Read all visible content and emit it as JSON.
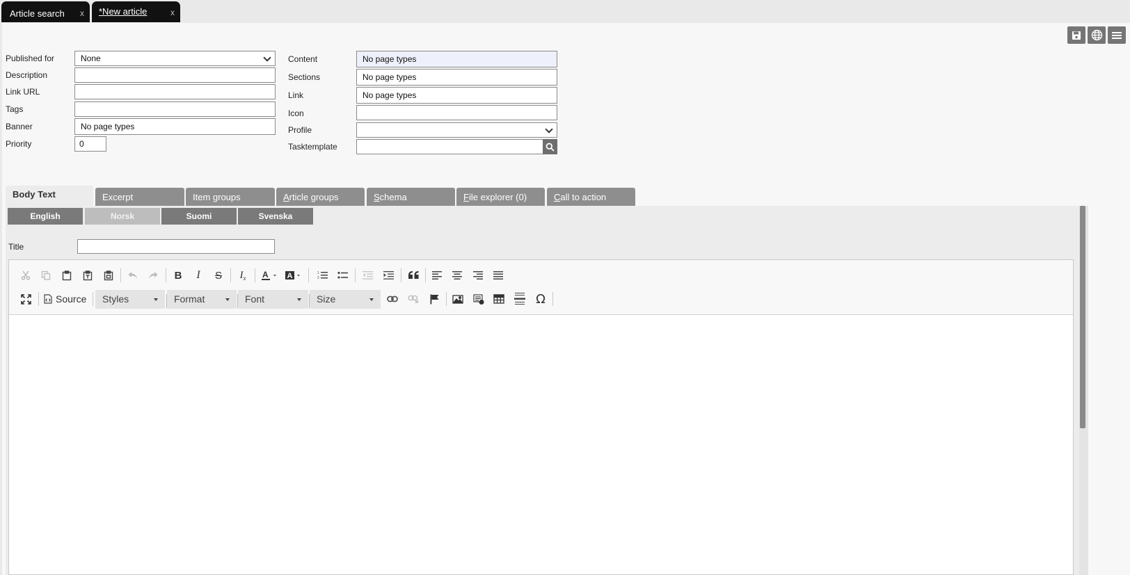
{
  "doc_tabs": [
    {
      "label": "Article search",
      "close": "x"
    },
    {
      "label": "*New article",
      "close": "x"
    }
  ],
  "top_icons": [
    "save-icon",
    "globe-icon",
    "menu-icon"
  ],
  "form_left": {
    "published_for": {
      "label": "Published for",
      "value": "None"
    },
    "description": {
      "label": "Description",
      "value": ""
    },
    "link_url": {
      "label": "Link URL",
      "value": ""
    },
    "tags": {
      "label": "Tags",
      "value": ""
    },
    "banner": {
      "label": "Banner",
      "value": "No page types"
    },
    "priority": {
      "label": "Priority",
      "value": "0"
    }
  },
  "form_right": {
    "content": {
      "label": "Content",
      "value": "No page types"
    },
    "sections": {
      "label": "Sections",
      "value": "No page types"
    },
    "link": {
      "label": "Link",
      "value": "No page types"
    },
    "icon": {
      "label": "Icon",
      "value": ""
    },
    "profile": {
      "label": "Profile",
      "value": ""
    },
    "tasktemplate": {
      "label": "Tasktemplate",
      "value": ""
    }
  },
  "section_tabs": [
    {
      "label": "Body Text",
      "access": "",
      "rest": ""
    },
    {
      "label": "Excerpt",
      "access": "",
      "rest": ""
    },
    {
      "label": "Item groups",
      "access": "",
      "rest": ""
    },
    {
      "label": "",
      "access": "A",
      "rest": "rticle groups"
    },
    {
      "label": "",
      "access": "S",
      "rest": "chema"
    },
    {
      "label": "",
      "access": "F",
      "rest": "ile explorer (0)"
    },
    {
      "label": "",
      "access": "C",
      "rest": "all to action"
    }
  ],
  "languages": [
    "English",
    "Norsk",
    "Suomi",
    "Svenska"
  ],
  "title_field": {
    "label": "Title",
    "value": ""
  },
  "editor": {
    "source_label": "Source",
    "combos": [
      "Styles",
      "Format",
      "Font",
      "Size"
    ]
  }
}
